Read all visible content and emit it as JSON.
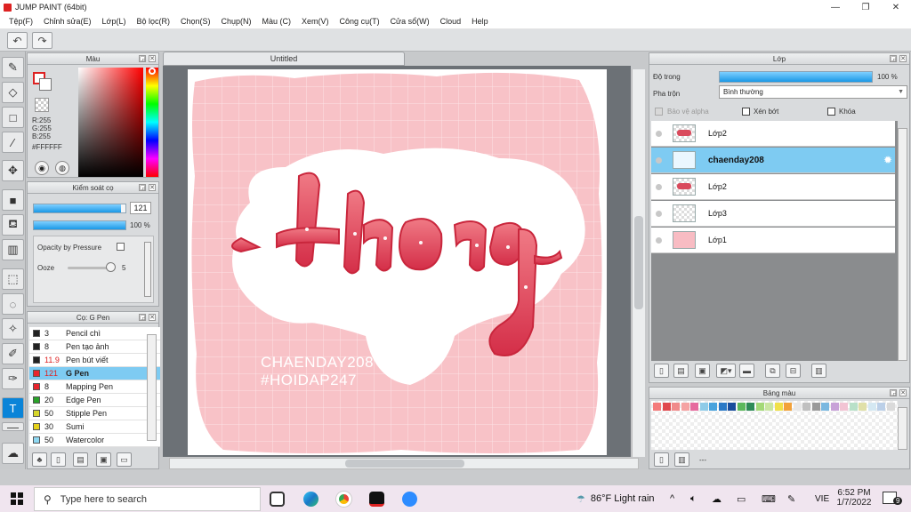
{
  "window": {
    "title": "JUMP PAINT (64bit)",
    "minimize": "—",
    "maximize": "❐",
    "close": "✕"
  },
  "menu": [
    "Tệp(F)",
    "Chỉnh sửa(E)",
    "Lớp(L)",
    "Bộ lọc(R)",
    "Chọn(S)",
    "Chụp(N)",
    "Màu (C)",
    "Xem(V)",
    "Công cụ(T)",
    "Cửa sổ(W)",
    "Cloud",
    "Help"
  ],
  "toolbar": {
    "undo_icon": "undo-icon",
    "redo_icon": "redo-icon"
  },
  "color_panel": {
    "title": "Màu",
    "r": "R:255",
    "g": "G:255",
    "b": "B:255",
    "hex": "#FFFFFF"
  },
  "brush_control": {
    "title": "Kiểm soát cọ",
    "size": "121",
    "size_fraction": 0.95,
    "opacity": "100 %",
    "opacity_fraction": 1.0,
    "opacity_by_pressure": "Opacity by Pressure",
    "ooze_label": "Ooze",
    "ooze_value": "5",
    "ooze_fraction": 0.95
  },
  "brush_list": {
    "title": "Cọ: G Pen",
    "items": [
      {
        "size": "3",
        "name": "Pencil chì",
        "color": "#222222"
      },
      {
        "size": "8",
        "name": "Pen tạo ảnh",
        "color": "#222222"
      },
      {
        "size": "11.9",
        "name": "Pen bút viết",
        "color": "#222222"
      },
      {
        "size": "121",
        "name": "G Pen",
        "color": "#e8242d"
      },
      {
        "size": "8",
        "name": "Mapping Pen",
        "color": "#e8242d"
      },
      {
        "size": "20",
        "name": "Edge Pen",
        "color": "#2aa32a"
      },
      {
        "size": "50",
        "name": "Stipple Pen",
        "color": "#d6d62a"
      },
      {
        "size": "30",
        "name": "Sumi",
        "color": "#e6d21a"
      },
      {
        "size": "50",
        "name": "Watercolor",
        "color": "#8ed8f2"
      }
    ]
  },
  "document": {
    "tab": "Untitled",
    "art_line1": "CHAENDAY208",
    "art_line2": "#HOIDAP247"
  },
  "layer_panel": {
    "title": "Lớp",
    "opacity_label": "Độ trong",
    "opacity_value": "100 %",
    "opacity_fraction": 1.0,
    "blend_label": "Pha trộn",
    "blend_value": "Bình thường",
    "protect_alpha": "Bảo vệ alpha",
    "clipping": "Xén bớt",
    "lock": "Khóa",
    "layers": [
      {
        "name": "Lớp2"
      },
      {
        "name": "chaenday208"
      },
      {
        "name": "Lớp2"
      },
      {
        "name": "Lớp3"
      },
      {
        "name": "Lớp1"
      }
    ]
  },
  "palette_panel": {
    "title": "Bảng màu",
    "footer": "---",
    "swatches": [
      "#f47b7b",
      "#e0474c",
      "#f08a8a",
      "#f5a3a3",
      "#e66a9e",
      "#8ecbe8",
      "#4aa3dd",
      "#2b79c6",
      "#1a4d9c",
      "#5cb85c",
      "#2e8b57",
      "#a3d977",
      "#c9e6a1",
      "#f0e04a",
      "#f2a23a",
      "#e8e8e8",
      "#c0c0c0",
      "#9a9a9a",
      "#7ab8e0",
      "#c8a2d8",
      "#f2c4d4",
      "#b8e0c8",
      "#e0e0a8",
      "#d4e8f2",
      "#bcd0e8",
      "#dadada"
    ]
  },
  "taskbar": {
    "search_placeholder": "Type here to search",
    "weather": "86°F  Light rain",
    "lang": "VIE",
    "time": "6:52 PM",
    "date": "1/7/2022",
    "notifications": "9"
  }
}
